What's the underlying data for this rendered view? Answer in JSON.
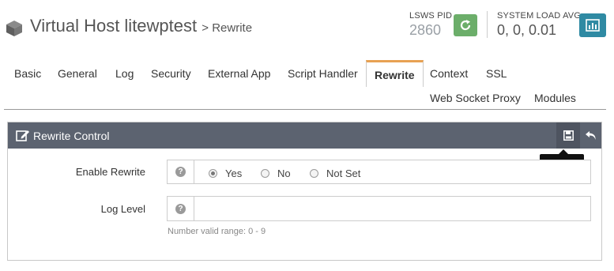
{
  "header": {
    "title": "Virtual Host litewptest",
    "subtitle": "> Rewrite",
    "pid_label": "LSWS PID",
    "pid_value": "2860",
    "load_label": "SYSTEM LOAD AVG",
    "load_value": "0, 0, 0.01",
    "restart_icon": "restart-icon",
    "chart_icon": "chart-icon",
    "colors": {
      "restart": "#6cae6a",
      "chart": "#2f8aa3"
    }
  },
  "tabs": [
    {
      "label": "Basic"
    },
    {
      "label": "General"
    },
    {
      "label": "Log"
    },
    {
      "label": "Security"
    },
    {
      "label": "External App"
    },
    {
      "label": "Script Handler"
    },
    {
      "label": "Rewrite",
      "active": true
    },
    {
      "label": "Context"
    },
    {
      "label": "SSL"
    },
    {
      "label": "Web Socket Proxy"
    },
    {
      "label": "Modules"
    }
  ],
  "panel": {
    "title": "Rewrite Control",
    "save_tooltip": "Save",
    "fields": {
      "enable_rewrite": {
        "label": "Enable Rewrite",
        "options": [
          "Yes",
          "No",
          "Not Set"
        ],
        "selected": "Yes"
      },
      "log_level": {
        "label": "Log Level",
        "value": "",
        "hint": "Number valid range: 0 - 9"
      }
    },
    "help_glyph": "?"
  }
}
